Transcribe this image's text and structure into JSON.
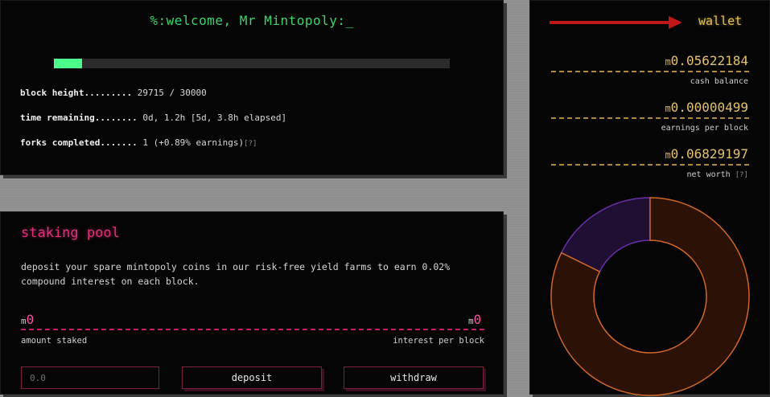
{
  "header": {
    "greeting": "%:welcome, Mr Mintopoly:_",
    "block_progress_fraction": 0.0705
  },
  "stats": {
    "block_height_label": "block height.........",
    "block_height_value": "29715 / 30000",
    "time_remaining_label": "time remaining........",
    "time_remaining_value": "0d, 1.2h [5d, 3.8h elapsed]",
    "forks_completed_label": "forks completed.......",
    "forks_completed_value": "1 (+0.89% earnings)",
    "help": "[?]"
  },
  "staking": {
    "title": "staking pool",
    "description": "deposit your spare mintopoly coins in our risk-free yield farms to earn 0.02% compound interest on each block.",
    "currency_prefix": "m",
    "amount_staked_value": "0",
    "amount_staked_label": "amount staked",
    "interest_value": "0",
    "interest_label": "interest per block",
    "input_placeholder": "0.0",
    "deposit_label": "deposit",
    "withdraw_label": "withdraw"
  },
  "wallet": {
    "title": "wallet",
    "currency_prefix": "m",
    "cash_balance_value": "0.05622184",
    "cash_balance_label": "cash balance",
    "earnings_value": "0.00000499",
    "earnings_label": "earnings per block",
    "net_worth_value": "0.06829197",
    "net_worth_label": "net worth",
    "help": "[?]",
    "donut_segments": [
      {
        "name": "staked/other",
        "fraction": 0.177,
        "color": "#6a2fa8",
        "fill": "#1e0f33"
      },
      {
        "name": "cash",
        "fraction": 0.823,
        "color": "#d0662a",
        "fill": "#2c1206"
      }
    ]
  },
  "colors": {
    "green_accent": "#3dd66e",
    "pink_accent": "#e0307a",
    "gold_accent": "#e6c250",
    "arrow_red": "#c01818"
  }
}
